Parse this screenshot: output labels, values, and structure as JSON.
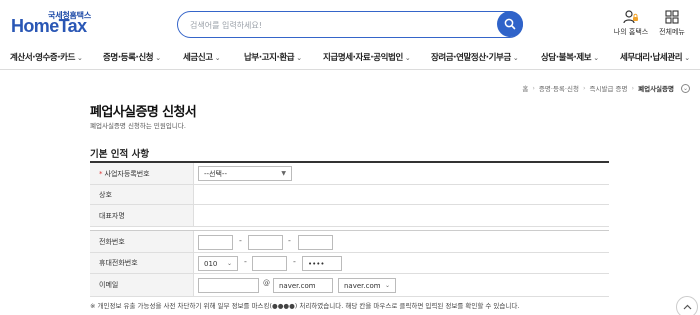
{
  "header": {
    "logo_top": "국세청홈택스",
    "logo_main": "HomeTax",
    "search_placeholder": "검색어를 입력하세요!",
    "my_hometax": "나의 홈택스",
    "all_menu": "전체메뉴"
  },
  "nav": {
    "items": [
      {
        "label": "계산서·영수증·카드"
      },
      {
        "label": "증명·등록·신청"
      },
      {
        "label": "세금신고"
      },
      {
        "label": "납부·고지·환급"
      },
      {
        "label": "지급명세·자료·공익법인"
      },
      {
        "label": "장려금·연말정산·기부금"
      },
      {
        "label": "상담·불복·제보"
      },
      {
        "label": "세무대리·납세관리"
      }
    ]
  },
  "breadcrumb": {
    "home": "홈",
    "items": [
      "증명·등록·신청",
      "즉시발급 증명"
    ],
    "current": "폐업사실증명"
  },
  "page": {
    "title": "폐업사실증명 신청서",
    "subtitle": "폐업사실증명 신청하는 민원입니다."
  },
  "form": {
    "section_title": "기본 인적 사항",
    "biz_no_label": "사업자등록번호",
    "biz_no_select": "--선택--",
    "company_label": "상호",
    "rep_label": "대표자명",
    "phone_label": "전화번호",
    "mobile_label": "휴대전화번호",
    "mobile_prefix": "010",
    "mobile_last": "••••",
    "email_label": "이메일",
    "email_at": "@",
    "email_domain": "naver.com",
    "email_domain_select": "naver.com",
    "dash": "-"
  },
  "footnote": "※ 개인정보 유출 가능성을 사전 차단하기 위해 일부 정보를 마스킹(●●●●) 처리하였습니다. 해당 칸을 마우스로 클릭하면 입력된 정보를 확인할 수 있습니다.",
  "colors": {
    "brand": "#2a57b5",
    "search_border": "#3565c9",
    "accent": "#f2a32a"
  }
}
